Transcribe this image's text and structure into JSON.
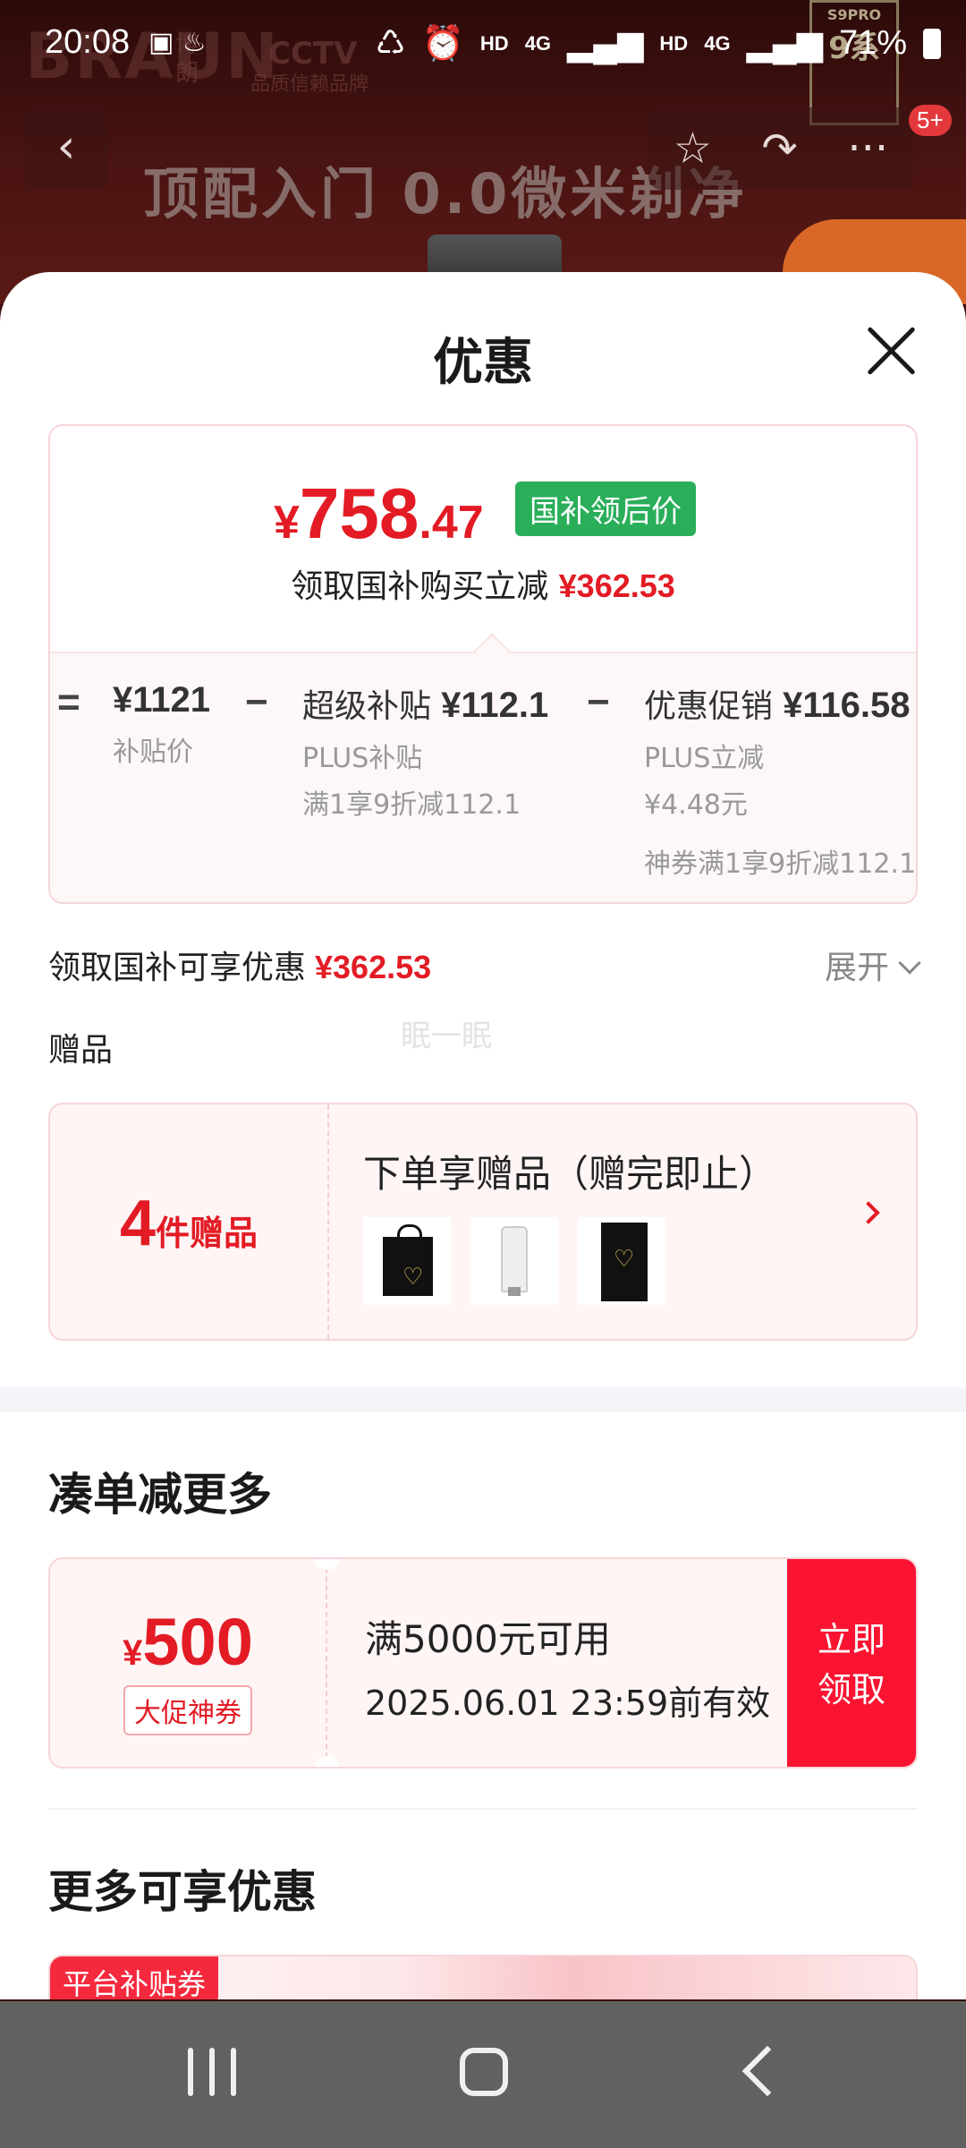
{
  "status_bar": {
    "time": "20:08",
    "network_label_1": "HD",
    "network_label_2": "4G",
    "network_label_3": "HD",
    "network_label_4": "4G",
    "battery": "71%"
  },
  "background_page": {
    "brand": "BRAUN",
    "brand_cn": "博朗",
    "cctv": "CCTV",
    "cctv_sub": "品质信赖品牌",
    "headline": "顶配入门 0.0微米剃净",
    "badge_model": "S9PRO",
    "badge_series": "9系",
    "notification_count": "5+"
  },
  "sheet": {
    "title": "优惠",
    "price": {
      "currency": "¥",
      "integer": "758",
      "decimal": ".47",
      "tag": "国补领后价",
      "subtitle": "领取国补购买立减",
      "subtitle_amount": "¥362.53"
    },
    "breakdown": {
      "equals": "=",
      "minus": "−",
      "base_price": "¥1121",
      "base_label": "补贴价",
      "subsidy_label": "超级补贴",
      "subsidy_amount": "¥112.1",
      "subsidy_line1": "PLUS补贴",
      "subsidy_line2": "满1享9折减112.1",
      "promo_label": "优惠促销",
      "promo_amount": "¥116.58",
      "promo_line1": "PLUS立减",
      "promo_line2": "¥4.48元",
      "promo_line3": "神券满1享9折减112.1"
    },
    "discount_row": {
      "label": "领取国补可享优惠",
      "amount": "¥362.53",
      "expand": "展开"
    },
    "watermark": "眠一眠",
    "gifts": {
      "section_label": "赠品",
      "count": "4",
      "count_suffix": "件赠品",
      "title": "下单享赠品（赠完即止）"
    },
    "combine": {
      "title": "凑单减更多",
      "coupon": {
        "currency": "¥",
        "amount": "500",
        "tag": "大促神券",
        "condition": "满5000元可用",
        "expiry": "2025.06.01 23:59前有效",
        "button_line1": "立即",
        "button_line2": "领取"
      }
    },
    "more": {
      "title": "更多可享优惠",
      "platform_tag": "平台补贴券"
    }
  },
  "colors": {
    "accent_red": "#e31b24",
    "button_red": "#fa1432",
    "tag_green": "#2aae5a"
  }
}
